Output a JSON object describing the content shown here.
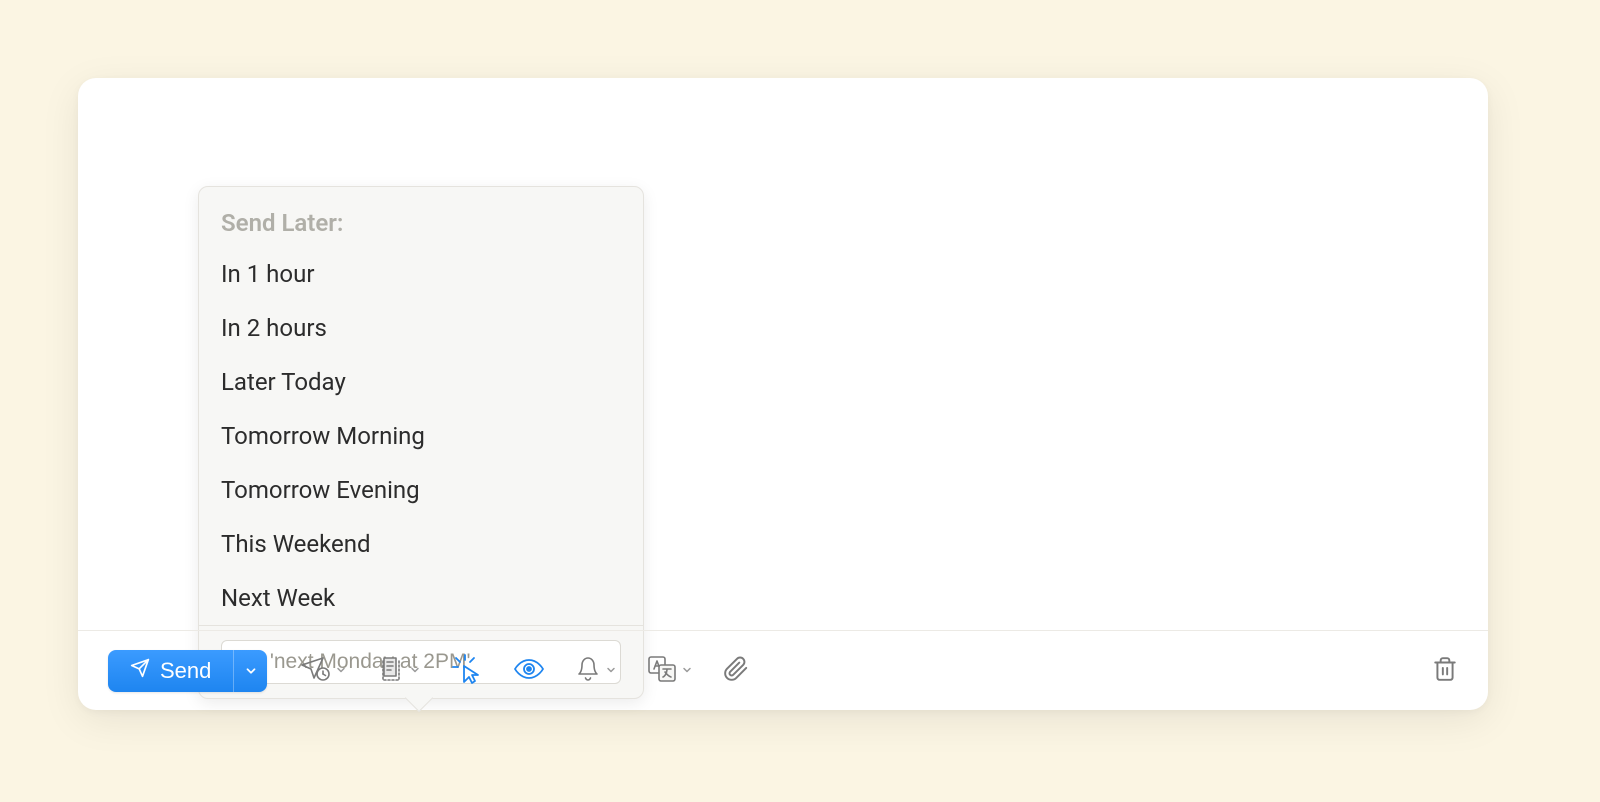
{
  "send_later": {
    "header": "Send Later:",
    "options": [
      "In 1 hour",
      "In 2 hours",
      "Later Today",
      "Tomorrow Morning",
      "Tomorrow Evening",
      "This Weekend",
      "Next Week"
    ],
    "custom_placeholder": "Or, 'next Monday at 2PM'"
  },
  "toolbar": {
    "send_label": "Send"
  }
}
